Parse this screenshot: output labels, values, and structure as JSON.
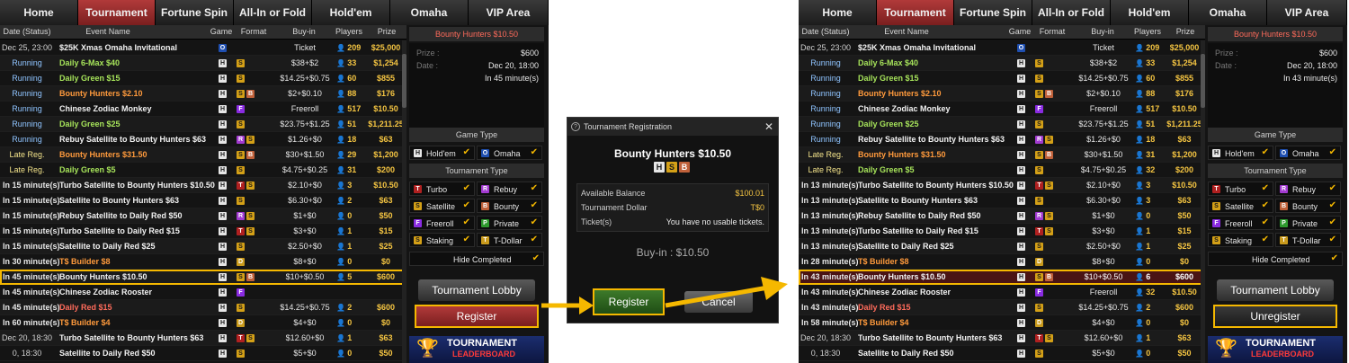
{
  "nav": [
    "Home",
    "Tournament",
    "Fortune Spin",
    "All-In or Fold",
    "Hold'em",
    "Omaha",
    "VIP Area"
  ],
  "columns": [
    "Date (Status)",
    "Event Name",
    "Game",
    "Format",
    "Buy-in",
    "Players",
    "Prize"
  ],
  "before": {
    "rows": [
      {
        "date": "Dec 25, 23:00",
        "name": "$25K Xmas Omaha Invitational",
        "game": "O",
        "format": [],
        "buyin": "Ticket",
        "players": "209",
        "prize": "$25,000"
      },
      {
        "date": "Running",
        "name": "Daily 6-Max $40",
        "game": "H",
        "format": [
          "S"
        ],
        "buyin": "$38+$2",
        "players": "33",
        "prize": "$1,254"
      },
      {
        "date": "Running",
        "name": "Daily Green $15",
        "game": "H",
        "format": [
          "S"
        ],
        "buyin": "$14.25+$0.75",
        "players": "60",
        "prize": "$855"
      },
      {
        "date": "Running",
        "name": "Bounty Hunters $2.10",
        "game": "H",
        "format": [
          "S",
          "B"
        ],
        "buyin": "$2+$0.10",
        "players": "88",
        "prize": "$176"
      },
      {
        "date": "Running",
        "name": "Chinese Zodiac Monkey",
        "game": "H",
        "format": [
          "F"
        ],
        "buyin": "Freeroll",
        "players": "517",
        "prize": "$10.50"
      },
      {
        "date": "Running",
        "name": "Daily Green $25",
        "game": "H",
        "format": [
          "S"
        ],
        "buyin": "$23.75+$1.25",
        "players": "51",
        "prize": "$1,211.25"
      },
      {
        "date": "Running",
        "name": "Rebuy Satellite to Bounty Hunters $63",
        "game": "H",
        "format": [
          "R",
          "S"
        ],
        "buyin": "$1.26+$0",
        "players": "18",
        "prize": "$63"
      },
      {
        "date": "Late Reg.",
        "name": "Bounty Hunters $31.50",
        "game": "H",
        "format": [
          "S",
          "B"
        ],
        "buyin": "$30+$1.50",
        "players": "29",
        "prize": "$1,200"
      },
      {
        "date": "Late Reg.",
        "name": "Daily Green $5",
        "game": "H",
        "format": [
          "S"
        ],
        "buyin": "$4.75+$0.25",
        "players": "31",
        "prize": "$200"
      },
      {
        "date": "In 15 minute(s)",
        "name": "Turbo Satellite to Bounty Hunters $10.50",
        "game": "H",
        "format": [
          "T",
          "S"
        ],
        "buyin": "$2.10+$0",
        "players": "3",
        "prize": "$10.50"
      },
      {
        "date": "In 15 minute(s)",
        "name": "Satellite to Bounty Hunters $63",
        "game": "H",
        "format": [
          "S"
        ],
        "buyin": "$6.30+$0",
        "players": "2",
        "prize": "$63"
      },
      {
        "date": "In 15 minute(s)",
        "name": "Rebuy Satellite to Daily Red $50",
        "game": "H",
        "format": [
          "R",
          "S"
        ],
        "buyin": "$1+$0",
        "players": "0",
        "prize": "$50"
      },
      {
        "date": "In 15 minute(s)",
        "name": "Turbo Satellite to Daily Red $15",
        "game": "H",
        "format": [
          "T",
          "S"
        ],
        "buyin": "$3+$0",
        "players": "1",
        "prize": "$15"
      },
      {
        "date": "In 15 minute(s)",
        "name": "Satellite to Daily Red $25",
        "game": "H",
        "format": [
          "S"
        ],
        "buyin": "$2.50+$0",
        "players": "1",
        "prize": "$25"
      },
      {
        "date": "In 30 minute(s)",
        "name": "T$ Builder $8",
        "game": "H",
        "format": [
          "D"
        ],
        "buyin": "$8+$0",
        "players": "0",
        "prize": "$0"
      },
      {
        "date": "In 45 minute(s)",
        "name": "Bounty Hunters $10.50",
        "game": "H",
        "format": [
          "S",
          "B"
        ],
        "buyin": "$10+$0.50",
        "players": "5",
        "prize": "$600"
      },
      {
        "date": "In 45 minute(s)",
        "name": "Chinese Zodiac Rooster",
        "game": "H",
        "format": [
          "F"
        ],
        "buyin": "",
        "players": "",
        "prize": ""
      },
      {
        "date": "In 45 minute(s)",
        "name": "Daily Red $15",
        "game": "H",
        "format": [
          "S"
        ],
        "buyin": "$14.25+$0.75",
        "players": "2",
        "prize": "$600"
      },
      {
        "date": "In 60 minute(s)",
        "name": "T$ Builder $4",
        "game": "H",
        "format": [
          "D"
        ],
        "buyin": "$4+$0",
        "players": "0",
        "prize": "$0"
      },
      {
        "date": "Dec 20, 18:30",
        "name": "Turbo Satellite to Bounty Hunters $63",
        "game": "H",
        "format": [
          "T",
          "S"
        ],
        "buyin": "$12.60+$0",
        "players": "1",
        "prize": "$63"
      },
      {
        "date": "0, 18:30",
        "name": "Satellite to Daily Red $50",
        "game": "H",
        "format": [
          "S"
        ],
        "buyin": "$5+$0",
        "players": "0",
        "prize": "$50"
      }
    ],
    "side": {
      "prize": "$600",
      "date": "Dec 20, 18:00",
      "starts": "In 45 minute(s)"
    },
    "action_button": "Register"
  },
  "after": {
    "rows": [
      {
        "date": "Dec 25, 23:00",
        "name": "$25K Xmas Omaha Invitational",
        "game": "O",
        "format": [],
        "buyin": "Ticket",
        "players": "209",
        "prize": "$25,000"
      },
      {
        "date": "Running",
        "name": "Daily 6-Max $40",
        "game": "H",
        "format": [
          "S"
        ],
        "buyin": "$38+$2",
        "players": "33",
        "prize": "$1,254"
      },
      {
        "date": "Running",
        "name": "Daily Green $15",
        "game": "H",
        "format": [
          "S"
        ],
        "buyin": "$14.25+$0.75",
        "players": "60",
        "prize": "$855"
      },
      {
        "date": "Running",
        "name": "Bounty Hunters $2.10",
        "game": "H",
        "format": [
          "S",
          "B"
        ],
        "buyin": "$2+$0.10",
        "players": "88",
        "prize": "$176"
      },
      {
        "date": "Running",
        "name": "Chinese Zodiac Monkey",
        "game": "H",
        "format": [
          "F"
        ],
        "buyin": "Freeroll",
        "players": "517",
        "prize": "$10.50"
      },
      {
        "date": "Running",
        "name": "Daily Green $25",
        "game": "H",
        "format": [
          "S"
        ],
        "buyin": "$23.75+$1.25",
        "players": "51",
        "prize": "$1,211.25"
      },
      {
        "date": "Running",
        "name": "Rebuy Satellite to Bounty Hunters $63",
        "game": "H",
        "format": [
          "R",
          "S"
        ],
        "buyin": "$1.26+$0",
        "players": "18",
        "prize": "$63"
      },
      {
        "date": "Late Reg.",
        "name": "Bounty Hunters $31.50",
        "game": "H",
        "format": [
          "S",
          "B"
        ],
        "buyin": "$30+$1.50",
        "players": "31",
        "prize": "$1,200"
      },
      {
        "date": "Late Reg.",
        "name": "Daily Green $5",
        "game": "H",
        "format": [
          "S"
        ],
        "buyin": "$4.75+$0.25",
        "players": "32",
        "prize": "$200"
      },
      {
        "date": "In 13 minute(s)",
        "name": "Turbo Satellite to Bounty Hunters $10.50",
        "game": "H",
        "format": [
          "T",
          "S"
        ],
        "buyin": "$2.10+$0",
        "players": "3",
        "prize": "$10.50"
      },
      {
        "date": "In 13 minute(s)",
        "name": "Satellite to Bounty Hunters $63",
        "game": "H",
        "format": [
          "S"
        ],
        "buyin": "$6.30+$0",
        "players": "3",
        "prize": "$63"
      },
      {
        "date": "In 13 minute(s)",
        "name": "Rebuy Satellite to Daily Red $50",
        "game": "H",
        "format": [
          "R",
          "S"
        ],
        "buyin": "$1+$0",
        "players": "0",
        "prize": "$50"
      },
      {
        "date": "In 13 minute(s)",
        "name": "Turbo Satellite to Daily Red $15",
        "game": "H",
        "format": [
          "T",
          "S"
        ],
        "buyin": "$3+$0",
        "players": "1",
        "prize": "$15"
      },
      {
        "date": "In 13 minute(s)",
        "name": "Satellite to Daily Red $25",
        "game": "H",
        "format": [
          "S"
        ],
        "buyin": "$2.50+$0",
        "players": "1",
        "prize": "$25"
      },
      {
        "date": "In 28 minute(s)",
        "name": "T$ Builder $8",
        "game": "H",
        "format": [
          "D"
        ],
        "buyin": "$8+$0",
        "players": "0",
        "prize": "$0"
      },
      {
        "date": "In 43 minute(s)",
        "name": "Bounty Hunters $10.50",
        "game": "H",
        "format": [
          "S",
          "B"
        ],
        "buyin": "$10+$0.50",
        "players": "6",
        "prize": "$600"
      },
      {
        "date": "In 43 minute(s)",
        "name": "Chinese Zodiac Rooster",
        "game": "H",
        "format": [
          "F"
        ],
        "buyin": "Freeroll",
        "players": "32",
        "prize": "$10.50"
      },
      {
        "date": "In 43 minute(s)",
        "name": "Daily Red $15",
        "game": "H",
        "format": [
          "S"
        ],
        "buyin": "$14.25+$0.75",
        "players": "2",
        "prize": "$600"
      },
      {
        "date": "In 58 minute(s)",
        "name": "T$ Builder $4",
        "game": "H",
        "format": [
          "D"
        ],
        "buyin": "$4+$0",
        "players": "0",
        "prize": "$0"
      },
      {
        "date": "Dec 20, 18:30",
        "name": "Turbo Satellite to Bounty Hunters $63",
        "game": "H",
        "format": [
          "T",
          "S"
        ],
        "buyin": "$12.60+$0",
        "players": "1",
        "prize": "$63"
      },
      {
        "date": "0, 18:30",
        "name": "Satellite to Daily Red $50",
        "game": "H",
        "format": [
          "S"
        ],
        "buyin": "$5+$0",
        "players": "0",
        "prize": "$50"
      }
    ],
    "side": {
      "prize": "$600",
      "date": "Dec 20, 18:00",
      "starts": "In 43 minute(s)"
    },
    "action_button": "Unregister"
  },
  "side_common": {
    "title": "Bounty Hunters $10.50",
    "prize_label": "Prize :",
    "date_label": "Date :",
    "game_type_label": "Game Type",
    "game_types": [
      {
        "icon": "H",
        "label": "Hold'em"
      },
      {
        "icon": "O",
        "label": "Omaha"
      }
    ],
    "tournament_type_label": "Tournament Type",
    "tournament_types": [
      {
        "icon": "T",
        "label": "Turbo"
      },
      {
        "icon": "R",
        "label": "Rebuy"
      },
      {
        "icon": "S",
        "label": "Satellite"
      },
      {
        "icon": "B",
        "label": "Bounty"
      },
      {
        "icon": "F",
        "label": "Freeroll"
      },
      {
        "icon": "P",
        "label": "Private"
      },
      {
        "icon": "S",
        "label": "Staking"
      },
      {
        "icon": "T",
        "label": "T-Dollar"
      }
    ],
    "hide_completed": "Hide Completed",
    "lobby_button": "Tournament Lobby",
    "banner_line1": "TOURNAMENT",
    "banner_line2": "LEADERBOARD"
  },
  "dialog": {
    "title": "Tournament Registration",
    "name": "Bounty Hunters  $10.50",
    "badges": [
      "H",
      "S",
      "B"
    ],
    "balance_label": "Available Balance",
    "balance_value": "$100.01",
    "tdollar_label": "Tournament Dollar",
    "tdollar_value": "T$0",
    "tickets_label": "Ticket(s)",
    "tickets_value": "You have no usable tickets.",
    "buyin": "Buy-in : $10.50",
    "register": "Register",
    "cancel": "Cancel"
  },
  "colors": {
    "highlight": "#f5b800",
    "active_tab": "#b13a3a",
    "arrow": "#f5b800"
  }
}
